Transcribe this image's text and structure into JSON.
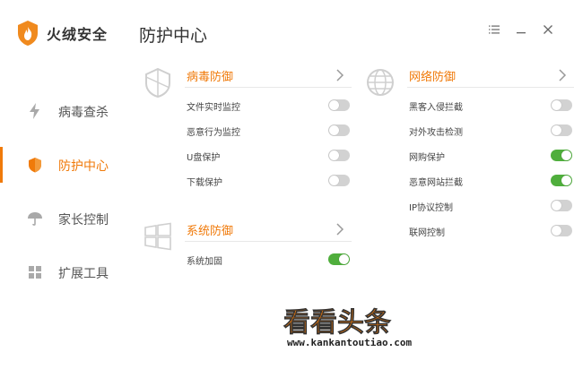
{
  "app": {
    "name": "火绒安全"
  },
  "colors": {
    "accent": "#f07a0a",
    "toggle_on": "#4fae3c",
    "toggle_off": "#d2d2d2"
  },
  "window": {
    "buttons": [
      {
        "icon": "menu-icon"
      },
      {
        "icon": "minimize-icon"
      },
      {
        "icon": "close-icon"
      }
    ]
  },
  "sidebar": {
    "items": [
      {
        "label": "病毒查杀",
        "icon": "lightning-icon",
        "active": false
      },
      {
        "label": "防护中心",
        "icon": "shield-icon",
        "active": true
      },
      {
        "label": "家长控制",
        "icon": "umbrella-icon",
        "active": false
      },
      {
        "label": "扩展工具",
        "icon": "grid-icon",
        "active": false
      }
    ]
  },
  "page": {
    "title": "防护中心"
  },
  "sections": {
    "virus": {
      "title": "病毒防御",
      "icon": "shield-outline-icon",
      "rows": [
        {
          "label": "文件实时监控",
          "on": false
        },
        {
          "label": "恶意行为监控",
          "on": false
        },
        {
          "label": "U盘保护",
          "on": false
        },
        {
          "label": "下载保护",
          "on": false
        }
      ]
    },
    "network": {
      "title": "网络防御",
      "icon": "globe-icon",
      "rows": [
        {
          "label": "黑客入侵拦截",
          "on": false
        },
        {
          "label": "对外攻击检测",
          "on": false
        },
        {
          "label": "网购保护",
          "on": true
        },
        {
          "label": "恶意网站拦截",
          "on": true
        },
        {
          "label": "IP协议控制",
          "on": false
        },
        {
          "label": "联网控制",
          "on": false
        }
      ]
    },
    "system": {
      "title": "系统防御",
      "icon": "windows-icon",
      "rows": [
        {
          "label": "系统加固",
          "on": true
        }
      ]
    }
  },
  "watermark": {
    "text": "看看头条",
    "url": "www.kankantoutiao.com"
  }
}
